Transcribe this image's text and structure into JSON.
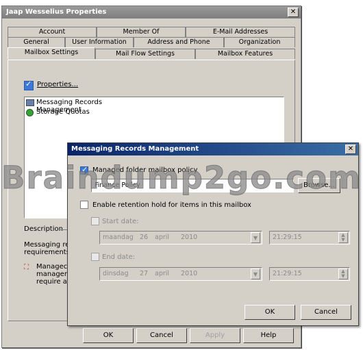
{
  "outer": {
    "title": "Jaap Wesselius Properties",
    "close_glyph": "✕",
    "tabs_row1": [
      "Account",
      "Member Of",
      "E-Mail Addresses"
    ],
    "tabs_row2": [
      "General",
      "User Information",
      "Address and Phone",
      "Organization"
    ],
    "tabs_row3": [
      "Mailbox Settings",
      "Mail Flow Settings",
      "Mailbox Features"
    ],
    "properties_label": "Properties...",
    "list_items": [
      {
        "label": "Messaging Records Management",
        "icon": "records-icon"
      },
      {
        "label": "Storage Quotas",
        "icon": "storage-icon"
      }
    ],
    "description_label": "Description",
    "description_text_1": "Messaging re",
    "description_text_2": "requirements",
    "description_bullet_1": "Managec",
    "description_bullet_2": "managen",
    "description_bullet_3": "require ar",
    "buttons": {
      "ok": "OK",
      "cancel": "Cancel",
      "apply": "Apply",
      "help": "Help"
    }
  },
  "modal": {
    "title": "Messaging Records Management",
    "close_glyph": "✕",
    "managed_folder_label": "Managed folder mailbox policy",
    "policy_value": "Finance Policy",
    "browse_label": "Browse...",
    "retention_label": "Enable retention hold for items in this mailbox",
    "start_label": "Start date:",
    "start_date": {
      "day": "maandag",
      "num": "26",
      "month": "april",
      "year": "2010",
      "time": "21:29:15"
    },
    "end_label": "End date:",
    "end_date": {
      "day": "dinsdag",
      "num": "27",
      "month": "april",
      "year": "2010",
      "time": "21:29:15"
    },
    "ok_label": "OK",
    "cancel_label": "Cancel"
  },
  "watermark": "Braindump2go.com"
}
